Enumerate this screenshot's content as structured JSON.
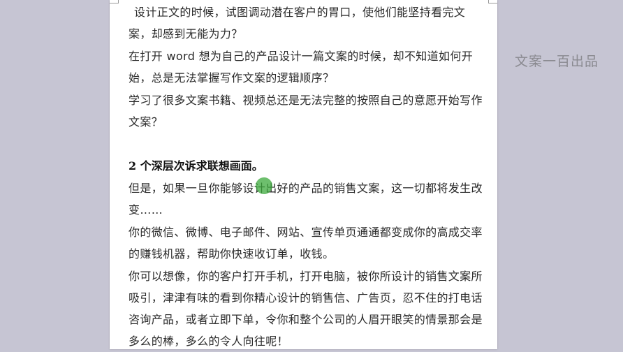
{
  "document": {
    "paragraphs": [
      "设计正文的时候，试图调动潜在客户的胃口，使他们能坚持看完文案，却感到无能为力？",
      "在打开 word 想为自己的产品设计一篇文案的时候，却不知道如何开始，总是无法掌握写作文案的逻辑顺序？",
      "学习了很多文案书籍、视频总还是无法完整的按照自己的意愿开始写作文案？"
    ],
    "heading": "2 个深层次诉求联想画面。",
    "paragraphs2": [
      "但是，如果一旦你能够设计出好的产品的销售文案，这一切都将发生改变……",
      "你的微信、微博、电子邮件、网站、宣传单页通通都变成你的高成交率的赚钱机器，帮助你快速收订单，收钱。",
      "你可以想像，你的客户打开手机，打开电脑，被你所设计的销售文案所吸引，津津有味的看到你精心设计的销售信、广告页，忍不住的打电话咨询产品，或者立即下单，令你和整个公司的人眉开眼笑的情景那会是多么的棒，多么的令人向往呢！"
    ]
  },
  "watermark": "文案一百出品"
}
